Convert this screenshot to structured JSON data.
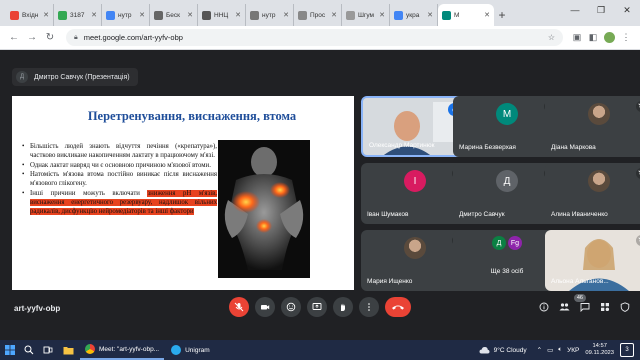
{
  "browser": {
    "tabs": [
      {
        "label": "Вхідн",
        "color": "#ea4335"
      },
      {
        "label": "3187",
        "color": "#34a853"
      },
      {
        "label": "нутр",
        "color": "#4285f4"
      },
      {
        "label": "Беск",
        "color": "#666666"
      },
      {
        "label": "ННЦ",
        "color": "#555555"
      },
      {
        "label": "нутр",
        "color": "#777777"
      },
      {
        "label": "Прос",
        "color": "#888888"
      },
      {
        "label": "Шгум",
        "color": "#999999"
      },
      {
        "label": "укра",
        "color": "#4285f4"
      },
      {
        "label": "M",
        "color": "#00897b",
        "active": true
      }
    ],
    "url": "meet.google.com/art-yyfv-obp"
  },
  "meet": {
    "presenter_initial": "Д",
    "presenter_label": "Дмитро Савчук (Презентація)",
    "meeting_code": "art-yyfv-obp",
    "participant_count": "46"
  },
  "slide": {
    "title": "Перетренування, виснаження, втома",
    "bullets": [
      {
        "text": "Більшість людей знають відчуття печіння («крепатура»), частково викликане накопиченням лактату в працюючому м'язі."
      },
      {
        "text": "Однак лактат навряд чи є основною причиною м'язової втоми."
      },
      {
        "text": "Натомість м'язова втома постійно виникає після виснаження м'язового глікогену."
      },
      {
        "text_plain": "Інші причини можуть включати ",
        "text_hl": "зниження рН м'язів, виснаження енергетичного резервуару, надлишок вільних радикалів, дисфункцію нейромедіаторів та інші фактори"
      }
    ]
  },
  "participants": [
    {
      "name": "Олександр Мартинюк",
      "state": "speaking",
      "type": "video"
    },
    {
      "name": "Марина Безверхая",
      "state": "muted",
      "initial": "М",
      "color": "#00897b"
    },
    {
      "name": "Діана Маркова",
      "state": "muted",
      "type": "photo"
    },
    {
      "name": "Іван Шумаков",
      "state": "muted",
      "initial": "І",
      "color": "#d81b60"
    },
    {
      "name": "Дмитро Савчук",
      "state": "muted",
      "initial": "Д",
      "color": "#5f6368"
    },
    {
      "name": "Алина Иваниченко",
      "state": "muted",
      "type": "photo"
    },
    {
      "name": "Мария Ищенко",
      "state": "muted",
      "type": "photo"
    },
    {
      "name": "Ще 38 осіб",
      "state": "none",
      "initials": [
        "Д",
        "Fg"
      ],
      "colors": [
        "#0b8043",
        "#8e24aa"
      ]
    },
    {
      "name": "Альона Альтанов...",
      "state": "muted",
      "type": "video"
    }
  ],
  "taskbar": {
    "apps": [
      {
        "label": "Meet: \"art-yyfv-obp...",
        "color": "#fbbc05",
        "active": true
      },
      {
        "label": "Unigram",
        "color": "#2aabee",
        "active": false
      }
    ],
    "weather": "9°C  Cloudy",
    "lang": "УКР",
    "time": "14:57",
    "date": "09.11.2023",
    "notif_count": "3"
  }
}
